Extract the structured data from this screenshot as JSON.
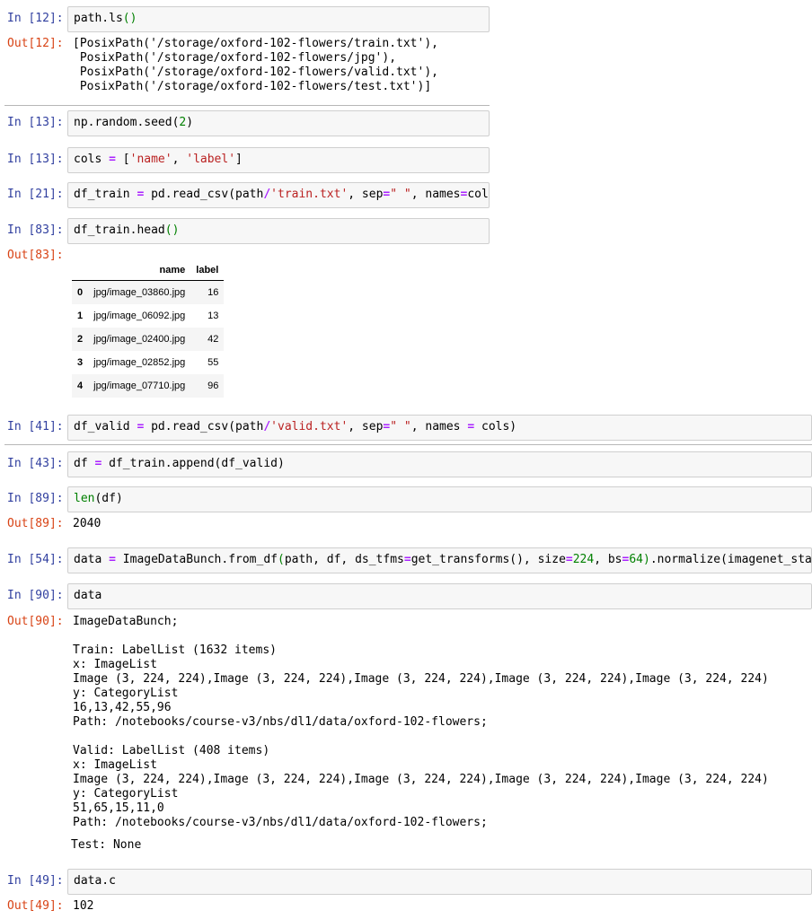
{
  "cells": {
    "c12": {
      "in": "In [12]:",
      "out": "Out[12]:",
      "code": [
        "path.ls",
        "()"
      ],
      "output": "[PosixPath('/storage/oxford-102-flowers/train.txt'),\n PosixPath('/storage/oxford-102-flowers/jpg'),\n PosixPath('/storage/oxford-102-flowers/valid.txt'),\n PosixPath('/storage/oxford-102-flowers/test.txt')]"
    },
    "c13a": {
      "in": "In [13]:",
      "code": [
        "np.random.seed(",
        "2",
        ")"
      ]
    },
    "c13b": {
      "in": "In [13]:",
      "code": [
        "cols ",
        "=",
        " [",
        "'name'",
        ", ",
        "'label'",
        "]"
      ]
    },
    "c21": {
      "in": "In [21]:",
      "code": [
        "df_train ",
        "=",
        " pd.read_csv(path",
        "/",
        "'train.txt'",
        ", sep",
        "=",
        "\" \"",
        ", names",
        "=",
        "cols)"
      ]
    },
    "c83": {
      "in": "In [83]:",
      "out": "Out[83]:",
      "code": [
        "df_train.head",
        "()"
      ]
    },
    "c41": {
      "in": "In [41]:",
      "code": [
        "df_valid ",
        "=",
        " pd.read_csv(path",
        "/",
        "'valid.txt'",
        ", sep",
        "=",
        "\" \"",
        ", names ",
        "=",
        " cols)"
      ]
    },
    "c43": {
      "in": "In [43]:",
      "code": [
        "df ",
        "=",
        " df_train.append(df_valid)"
      ]
    },
    "c89": {
      "in": "In [89]:",
      "out": "Out[89]:",
      "code": [
        "len",
        "(df)"
      ],
      "output": "2040"
    },
    "c54": {
      "in": "In [54]:",
      "code": [
        "data ",
        "=",
        " ImageDataBunch.from_df",
        "(",
        "path, df, ds_tfms",
        "=",
        "get_transforms(), size",
        "=",
        "224",
        ", bs",
        "=",
        "64",
        ")",
        ".normalize(imagenet_stats)"
      ]
    },
    "c90": {
      "in": "In [90]:",
      "out": "Out[90]:",
      "code": [
        "data"
      ],
      "output": "ImageDataBunch;\n\nTrain: LabelList (1632 items)\nx: ImageList\nImage (3, 224, 224),Image (3, 224, 224),Image (3, 224, 224),Image (3, 224, 224),Image (3, 224, 224)\ny: CategoryList\n16,13,42,55,96\nPath: /notebooks/course-v3/nbs/dl1/data/oxford-102-flowers;\n\nValid: LabelList (408 items)\nx: ImageList\nImage (3, 224, 224),Image (3, 224, 224),Image (3, 224, 224),Image (3, 224, 224),Image (3, 224, 224)\ny: CategoryList\n51,65,15,11,0\nPath: /notebooks/course-v3/nbs/dl1/data/oxford-102-flowers;",
      "output_tail": "Test: None"
    },
    "c49": {
      "in": "In [49]:",
      "out": "Out[49]:",
      "code": [
        "data.c"
      ],
      "output": "102"
    }
  },
  "dataframe": {
    "columns": [
      "",
      "name",
      "label"
    ],
    "rows": [
      {
        "idx": "0",
        "name": "jpg/image_03860.jpg",
        "label": "16"
      },
      {
        "idx": "1",
        "name": "jpg/image_06092.jpg",
        "label": "13"
      },
      {
        "idx": "2",
        "name": "jpg/image_02400.jpg",
        "label": "42"
      },
      {
        "idx": "3",
        "name": "jpg/image_02852.jpg",
        "label": "55"
      },
      {
        "idx": "4",
        "name": "jpg/image_07710.jpg",
        "label": "96"
      }
    ]
  },
  "colors": {
    "in_prompt": "#303f9f",
    "out_prompt": "#d84315",
    "keyword": "#008000",
    "operator": "#aa22ff",
    "string": "#ba2121"
  }
}
